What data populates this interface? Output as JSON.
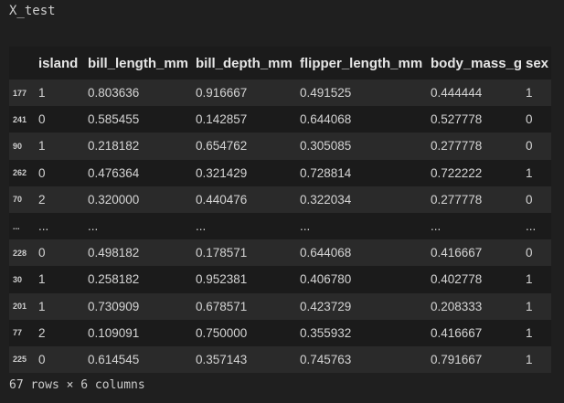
{
  "output_label": "X_test",
  "table": {
    "columns": [
      "",
      "island",
      "bill_length_mm",
      "bill_depth_mm",
      "flipper_length_mm",
      "body_mass_g",
      "sex"
    ],
    "rows": [
      [
        "177",
        "1",
        "0.803636",
        "0.916667",
        "0.491525",
        "0.444444",
        "1"
      ],
      [
        "241",
        "0",
        "0.585455",
        "0.142857",
        "0.644068",
        "0.527778",
        "0"
      ],
      [
        "90",
        "1",
        "0.218182",
        "0.654762",
        "0.305085",
        "0.277778",
        "0"
      ],
      [
        "262",
        "0",
        "0.476364",
        "0.321429",
        "0.728814",
        "0.722222",
        "1"
      ],
      [
        "70",
        "2",
        "0.320000",
        "0.440476",
        "0.322034",
        "0.277778",
        "0"
      ],
      [
        "...",
        "...",
        "...",
        "...",
        "...",
        "...",
        "..."
      ],
      [
        "228",
        "0",
        "0.498182",
        "0.178571",
        "0.644068",
        "0.416667",
        "0"
      ],
      [
        "30",
        "1",
        "0.258182",
        "0.952381",
        "0.406780",
        "0.402778",
        "1"
      ],
      [
        "201",
        "1",
        "0.730909",
        "0.678571",
        "0.423729",
        "0.208333",
        "1"
      ],
      [
        "77",
        "2",
        "0.109091",
        "0.750000",
        "0.355932",
        "0.416667",
        "1"
      ],
      [
        "225",
        "0",
        "0.614545",
        "0.357143",
        "0.745763",
        "0.791667",
        "1"
      ]
    ]
  },
  "summary": "67 rows × 6 columns"
}
